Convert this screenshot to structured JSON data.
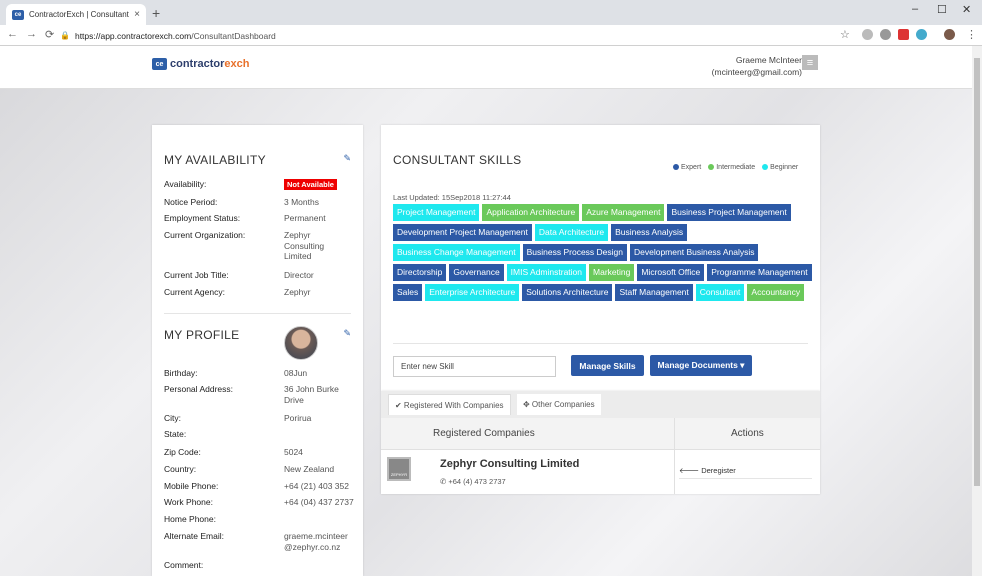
{
  "browser": {
    "tab_title": "ContractorExch | Consultant",
    "tab_close": "×",
    "new_tab": "+",
    "url_host": "https://app.contractorexch.com",
    "url_path": "/ConsultantDashboard",
    "win_min": "–",
    "win_max": "☐",
    "win_close": "✕"
  },
  "header": {
    "logo_mark": "ce",
    "brand_main": "contractor",
    "brand_accent": "exch",
    "user_name": "Graeme McInteer",
    "user_email": "(mcinteerg@gmail.com)"
  },
  "availability": {
    "title": "MY AVAILABILITY",
    "rows": [
      {
        "label": "Availability:",
        "value": "Not Available"
      },
      {
        "label": "Notice Period:",
        "value": "3 Months"
      },
      {
        "label": "Employment Status:",
        "value": "Permanent"
      },
      {
        "label": "Current Organization:",
        "value": "Zephyr Consulting Limited"
      },
      {
        "label": "Current Job Title:",
        "value": "Director"
      },
      {
        "label": "Current Agency:",
        "value": "Zephyr"
      }
    ]
  },
  "profile": {
    "title": "MY PROFILE",
    "rows": [
      {
        "label": "Birthday:",
        "value": "08Jun"
      },
      {
        "label": "Personal Address:",
        "value": "36 John Burke Drive"
      },
      {
        "label": "City:",
        "value": "Porirua"
      },
      {
        "label": "State:",
        "value": ""
      },
      {
        "label": "Zip Code:",
        "value": "5024"
      },
      {
        "label": "Country:",
        "value": "New Zealand"
      },
      {
        "label": "Mobile Phone:",
        "value": "+64 (21) 403 352"
      },
      {
        "label": "Work Phone:",
        "value": "+64 (04) 437 2737"
      },
      {
        "label": "Home Phone:",
        "value": ""
      },
      {
        "label": "Alternate Email:",
        "value": "graeme.mcinteer@zephyr.co.nz"
      },
      {
        "label": "Comment:",
        "value": ""
      }
    ]
  },
  "skills": {
    "title": "CONSULTANT SKILLS",
    "legend": [
      "Expert",
      "Intermediate",
      "Beginner"
    ],
    "legend_colors": [
      "#2c59a6",
      "#6ac95a",
      "#1ee8ee"
    ],
    "last_updated": "Last Updated: 15Sep2018 11:27:44",
    "items": [
      {
        "name": "Project Management",
        "level": "beginner"
      },
      {
        "name": "Application Architecture",
        "level": "intermediate"
      },
      {
        "name": "Azure Management",
        "level": "intermediate"
      },
      {
        "name": "Business Project Management",
        "level": "expert"
      },
      {
        "name": "Development Project Management",
        "level": "expert"
      },
      {
        "name": "Data Architecture",
        "level": "beginner"
      },
      {
        "name": "Business Analysis",
        "level": "expert"
      },
      {
        "name": "Business Change Management",
        "level": "beginner"
      },
      {
        "name": "Business Process Design",
        "level": "expert"
      },
      {
        "name": "Development Business Analysis",
        "level": "expert"
      },
      {
        "name": "Directorship",
        "level": "expert"
      },
      {
        "name": "Governance",
        "level": "expert"
      },
      {
        "name": "IMIS Adminstration",
        "level": "beginner"
      },
      {
        "name": "Marketing",
        "level": "intermediate"
      },
      {
        "name": "Microsoft Office",
        "level": "expert"
      },
      {
        "name": "Programme Management",
        "level": "expert"
      },
      {
        "name": "Sales",
        "level": "expert"
      },
      {
        "name": "Enterprise Architecture",
        "level": "beginner"
      },
      {
        "name": "Solutions Architecture",
        "level": "expert"
      },
      {
        "name": "Staff Management",
        "level": "expert"
      },
      {
        "name": "Consultant",
        "level": "beginner"
      },
      {
        "name": "Accountancy",
        "level": "intermediate"
      }
    ],
    "input_placeholder": "Enter new Skill",
    "manage_skills": "Manage Skills",
    "manage_documents": "Manage Documents ▾"
  },
  "companies": {
    "tab_registered": "✔ Registered With Companies",
    "tab_other": "✥ Other Companies",
    "col_registered": "Registered Companies",
    "col_actions": "Actions",
    "rows": [
      {
        "name": "Zephyr Consulting Limited",
        "phone": "+64 (4) 473 2737",
        "action": "🡐 Deregister",
        "logo_text": "ZEPHYR"
      }
    ]
  }
}
